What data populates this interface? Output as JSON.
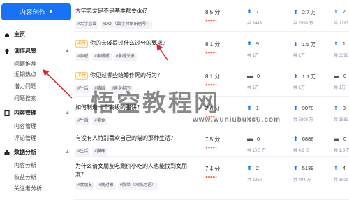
{
  "sidebar": {
    "create_button": "内容创作",
    "sections": [
      {
        "label": "主页",
        "items": []
      },
      {
        "label": "创作灵感",
        "items": [
          "问题推荐",
          "近期热点",
          "潜力问题",
          "问题搜索"
        ]
      },
      {
        "label": "内容管理",
        "items": [
          "内容管理",
          "评论管理"
        ]
      },
      {
        "label": "数据分析",
        "items": [
          "内容分析",
          "收益分析",
          "关注者分析"
        ]
      }
    ]
  },
  "rows": [
    {
      "title": "大学恋爱是不是基本都要doi？",
      "new": "",
      "tags": [
        "#大学恋爱",
        "#DOI（数字对象识别号）"
      ],
      "score": "8.5 分",
      "stars": 4,
      "m1": "7",
      "m1_sub": "共 3446",
      "m2": "2.7 万",
      "m2_sub": "共 2599 万",
      "m3": "2",
      "m3_sub": "共 1293",
      "m1_icon": "up",
      "m3_icon": "up"
    },
    {
      "title": "你的亲戚提过什么过分的要求？",
      "new": "上升",
      "tags": [
        "#亲戚",
        "#亲戚戚",
        "#亲戚关系"
      ],
      "score": "8.1 分",
      "stars": 4,
      "m1": "9",
      "m1_sub": "共 1万",
      "m2": "1.5 万",
      "m2_sub": "共 1万",
      "m3": "1",
      "m3_sub": "共 3396",
      "m1_icon": "up",
      "m3_icon": "up"
    },
    {
      "title": "你见过哪些结婚作死的行为？",
      "new": "上升",
      "tags": [
        "#生活",
        "#结婚",
        "#亲身经历"
      ],
      "score": "8.1 分",
      "stars": 4,
      "m1": "0",
      "m1_sub": "共 1万",
      "m2": "1.1 万",
      "m2_sub": "共 1万",
      "m3": "0",
      "m3_sub": "共 1万",
      "m1_icon": "dash",
      "m3_icon": "dash"
    },
    {
      "title": "如何制造一个高级的甜饼？",
      "new": "",
      "tags": [
        "#生活",
        "#美食"
      ],
      "score": "7.6 分",
      "stars": 4,
      "m1": "1",
      "m1_sub": "共 1万",
      "m2": "9078",
      "m2_sub": "共 5803 万",
      "m3": "3",
      "m3_sub": "共 1583",
      "m1_icon": "up",
      "m3_icon": "up"
    },
    {
      "title": "有没有人特别喜欢自己的猫的那种生活？",
      "new": "",
      "tags": [
        "#生活",
        "#猫咪"
      ],
      "score": "7.5 分",
      "stars": 4,
      "m1": "0",
      "m1_sub": "共 10.5 万",
      "m2": "6888",
      "m2_sub": "共 4.9 亿",
      "m3": "0",
      "m3_sub": "共 1.8 万",
      "m1_icon": "dash",
      "m3_icon": "dash"
    },
    {
      "title": "为什么请女朋友吃涮价小吃的人也能找到女朋友？",
      "new": "",
      "tags": [
        "#女朋友",
        "#找对象",
        "#脱单（网络用语）"
      ],
      "score": "7.4 分",
      "stars": 4,
      "m1": "2",
      "m1_sub": "共 2950",
      "m2": "5139",
      "m2_sub": "共 494 万",
      "m3": "4",
      "m3_sub": "共 1909",
      "m1_icon": "up",
      "m3_icon": "up"
    }
  ],
  "watermark": {
    "text": "悟空教程网",
    "url": "www.wuniubukou.com"
  },
  "colors": {
    "accent": "#1772f6",
    "star": "#f65a3b",
    "annotation": "#e0202a"
  }
}
